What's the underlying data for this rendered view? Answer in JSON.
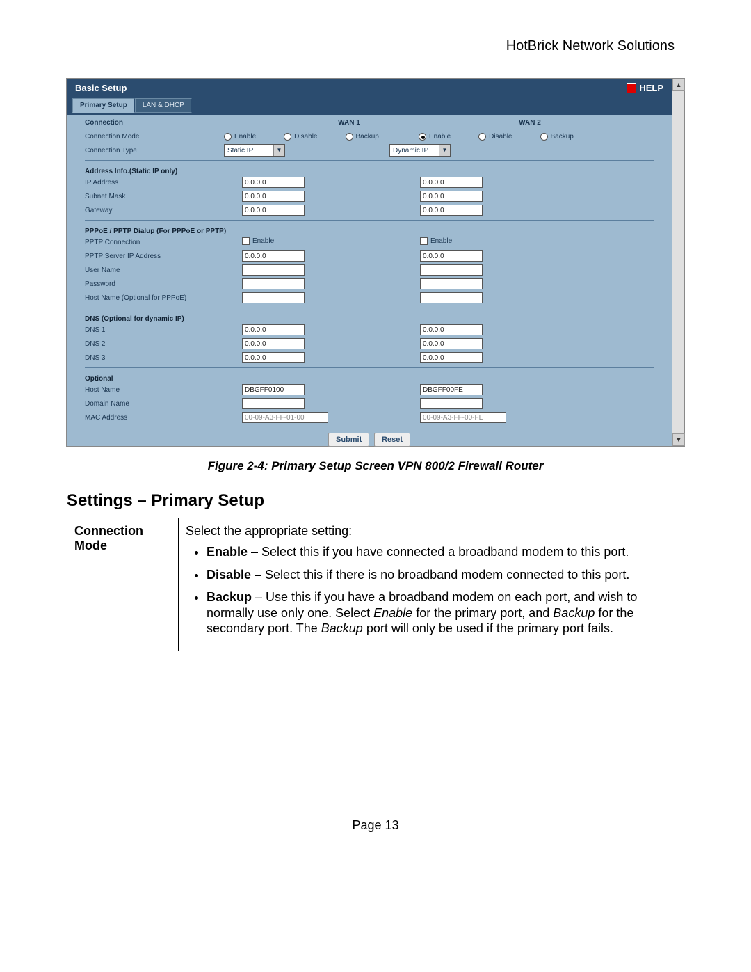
{
  "header": "HotBrick Network Solutions",
  "panel": {
    "title": "Basic Setup",
    "help": "HELP",
    "tabs": {
      "primary": "Primary Setup",
      "lan": "LAN & DHCP"
    },
    "headers": {
      "connection": "Connection",
      "wan1": "WAN 1",
      "wan2": "WAN 2",
      "addr": "Address Info.(Static IP only)",
      "pppoe": "PPPoE / PPTP Dialup (For PPPoE or PPTP)",
      "dns": "DNS (Optional for dynamic IP)",
      "optional": "Optional"
    },
    "labels": {
      "mode": "Connection Mode",
      "type": "Connection Type",
      "ip": "IP Address",
      "mask": "Subnet Mask",
      "gw": "Gateway",
      "pptp": "PPTP Connection",
      "pptp_ip": "PPTP Server IP Address",
      "user": "User Name",
      "pass": "Password",
      "hostpppoe": "Host Name (Optional for PPPoE)",
      "dns1": "DNS 1",
      "dns2": "DNS 2",
      "dns3": "DNS 3",
      "host": "Host Name",
      "domain": "Domain Name",
      "mac": "MAC Address"
    },
    "radios": {
      "enable": "Enable",
      "disable": "Disable",
      "backup": "Backup"
    },
    "conn_type": {
      "wan1": "Static IP",
      "wan2": "Dynamic IP"
    },
    "vals": {
      "zero": "0.0.0.0",
      "host_w1": "DBGFF0100",
      "host_w2": "DBGFF00FE",
      "mac_w1": "00-09-A3-FF-01-00",
      "mac_w2": "00-09-A3-FF-00-FE"
    },
    "buttons": {
      "submit": "Submit",
      "reset": "Reset"
    }
  },
  "caption": "Figure 2-4: Primary Setup Screen VPN 800/2 Firewall Router",
  "settings": {
    "heading": "Settings – Primary Setup",
    "rowlabel": "Connection Mode",
    "intro": "Select the appropriate setting:",
    "bullets": {
      "enable_b": "Enable",
      "enable_t": " – Select this if you have connected a broadband modem to this port.",
      "disable_b": "Disable",
      "disable_t": " – Select this if there is no broadband modem connected to this port.",
      "backup_b": "Backup",
      "backup_t1": " – Use this if you have a broadband modem on each port, and wish to normally use only one. Select ",
      "backup_i1": "Enable",
      "backup_t2": " for the primary port, and ",
      "backup_i2": "Backup",
      "backup_t3": " for the secondary port. The ",
      "backup_i3": "Backup",
      "backup_t4": " port will only be used if the primary port fails."
    }
  },
  "pageNum": "Page 13"
}
